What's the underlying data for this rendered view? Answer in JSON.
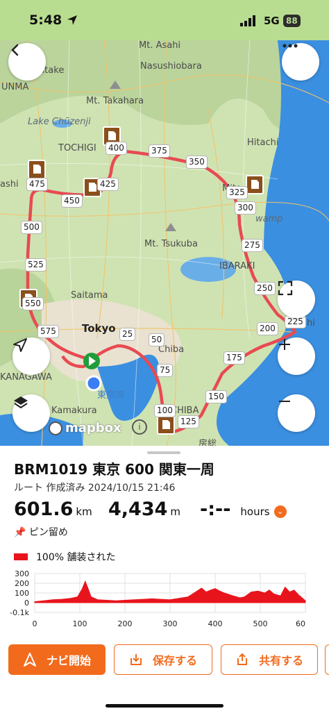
{
  "status_bar": {
    "time": "5:48",
    "network": "5G",
    "battery": "88"
  },
  "map": {
    "labels": {
      "mt_asahi": "Mt. Asahi",
      "nasushiobara": "Nasushiobara",
      "agatake": "agatake",
      "unma": "UNMA",
      "mt_takahara": "Mt. Takahara",
      "lake_chuzenji": "Lake Chūzenji",
      "tochigi": "TOCHIGI",
      "hitachi": "Hitachi",
      "ashi": "ashi",
      "mito": "Mito",
      "swamp": "wamp",
      "mt_tsukuba": "Mt. Tsukuba",
      "ibaraki": "IBARAKI",
      "saitama": "Saitama",
      "tokyo": "Tokyo",
      "choshi": "Choshi",
      "chiba": "Chiba",
      "kanagawa": "KANAGAWA",
      "tokyo_bay": "東京湾",
      "kamakura": "Kamakura",
      "chiba_pref": "CHIBA",
      "boso": "房総"
    },
    "km_markers": [
      "400",
      "375",
      "350",
      "475",
      "425",
      "450",
      "325",
      "300",
      "500",
      "275",
      "525",
      "250",
      "550",
      "575",
      "25",
      "50",
      "225",
      "200",
      "75",
      "175",
      "150",
      "100",
      "125"
    ],
    "attribution": "mapbox",
    "info_icon": "i"
  },
  "icons": {
    "back": "chevron-left-icon",
    "more": "more-horizontal-icon",
    "fullscreen": "fullscreen-icon",
    "locate": "navigation-arrow-icon",
    "zoom_in": "plus-icon",
    "zoom_out": "minus-icon",
    "layers": "layers-icon"
  },
  "route": {
    "title": "BRM1019 東京 600 関東一周",
    "meta": "ルート 作成済み 2024/10/15 21:46",
    "distance_value": "601.6",
    "distance_unit": "km",
    "elevation_value": "4,434",
    "elevation_unit": "m",
    "time_value": "-:--",
    "time_unit": "hours",
    "pinned_label": "ピン留め",
    "paved_label": "100% 舗装された"
  },
  "chart_data": {
    "type": "area",
    "title": "",
    "xlabel": "",
    "ylabel": "",
    "x_ticks": [
      "0",
      "100",
      "200",
      "300",
      "400",
      "500",
      "60"
    ],
    "y_ticks": [
      "300",
      "200",
      "100",
      "0",
      "-0.1k"
    ],
    "xlim": [
      0,
      600
    ],
    "ylim": [
      -100,
      300
    ],
    "grid": true,
    "series": [
      {
        "color": "#e8141c",
        "x": [
          0,
          10,
          20,
          40,
          60,
          80,
          95,
          105,
          112,
          118,
          125,
          140,
          160,
          180,
          200,
          220,
          240,
          260,
          280,
          300,
          320,
          340,
          350,
          360,
          370,
          380,
          390,
          400,
          410,
          420,
          440,
          455,
          465,
          480,
          495,
          510,
          520,
          530,
          545,
          555,
          565,
          575,
          585,
          595,
          600
        ],
        "y": [
          10,
          15,
          20,
          30,
          35,
          45,
          60,
          140,
          220,
          150,
          60,
          30,
          25,
          20,
          25,
          30,
          35,
          40,
          35,
          30,
          45,
          60,
          90,
          120,
          150,
          110,
          130,
          145,
          120,
          100,
          70,
          50,
          60,
          110,
          120,
          100,
          130,
          90,
          70,
          160,
          110,
          130,
          80,
          40,
          20
        ]
      }
    ]
  },
  "buttons": {
    "nav": "ナビ開始",
    "save": "保存する",
    "share": "共有する"
  }
}
